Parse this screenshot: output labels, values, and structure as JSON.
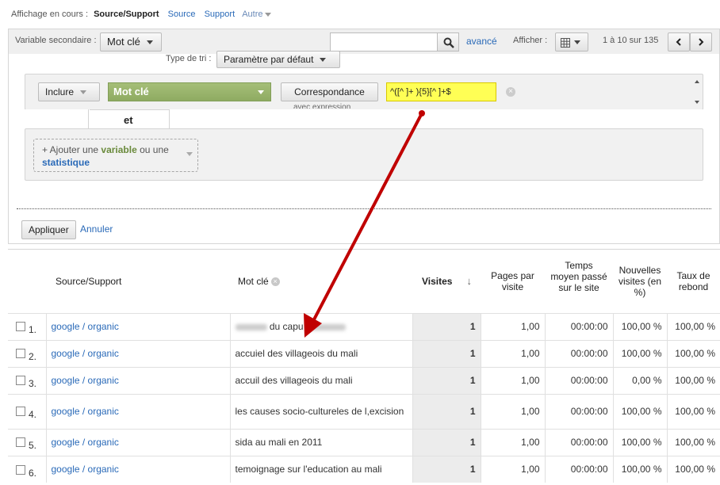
{
  "view_line": {
    "label": "Affichage en cours :",
    "current": "Source/Support",
    "links": [
      "Source",
      "Support"
    ],
    "other": "Autre"
  },
  "toolbar": {
    "secondary_label": "Variable secondaire :",
    "secondary_value": "Mot clé",
    "search_value": "",
    "advanced_label": "avancé",
    "display_label": "Afficher :",
    "pagination": "1 à 10 sur 135"
  },
  "filter": {
    "sort_label": "Type de tri :",
    "sort_value": "Paramètre par défaut",
    "include_label": "Inclure",
    "dimension": "Mot clé",
    "match_label": "Correspondance",
    "match_sub": "avec expression",
    "regex": "^([^ ]+ ){5}[^ ]+$",
    "and_label": "et",
    "add_prefix": "+ Ajouter une",
    "add_variable": "variable",
    "add_middle": "ou une",
    "add_metric": "statistique",
    "apply_label": "Appliquer",
    "cancel_label": "Annuler"
  },
  "table": {
    "headers": {
      "source": "Source/Support",
      "keyword": "Mot clé",
      "visits": "Visites",
      "pages": "Pages par visite",
      "time": "Temps moyen passé sur le site",
      "new_visits": "Nouvelles visites (en %)",
      "bounce": "Taux de rebond"
    },
    "rows": [
      {
        "num": "1.",
        "source": "google / organic",
        "keyword": "du capu",
        "visits": "1",
        "pages": "1,00",
        "time": "00:00:00",
        "new": "100,00 %",
        "bounce": "100,00 %"
      },
      {
        "num": "2.",
        "source": "google / organic",
        "keyword": "accuiel des villageois du mali",
        "visits": "1",
        "pages": "1,00",
        "time": "00:00:00",
        "new": "100,00 %",
        "bounce": "100,00 %"
      },
      {
        "num": "3.",
        "source": "google / organic",
        "keyword": "accuil des villageois du mali",
        "visits": "1",
        "pages": "1,00",
        "time": "00:00:00",
        "new": "0,00 %",
        "bounce": "100,00 %"
      },
      {
        "num": "4.",
        "source": "google / organic",
        "keyword": "les causes socio-cultureles de l,excision",
        "visits": "1",
        "pages": "1,00",
        "time": "00:00:00",
        "new": "100,00 %",
        "bounce": "100,00 %"
      },
      {
        "num": "5.",
        "source": "google / organic",
        "keyword": "sida au mali en 2011",
        "visits": "1",
        "pages": "1,00",
        "time": "00:00:00",
        "new": "100,00 %",
        "bounce": "100,00 %"
      },
      {
        "num": "6.",
        "source": "google / organic",
        "keyword": "temoignage sur l'education au mali",
        "visits": "1",
        "pages": "1,00",
        "time": "00:00:00",
        "new": "100,00 %",
        "bounce": "100,00 %"
      }
    ]
  },
  "colors": {
    "accent_link": "#2a6ab8",
    "dimension_green": "#98b36a",
    "regex_highlight": "#ffff55",
    "annotation_arrow": "#c00000"
  }
}
